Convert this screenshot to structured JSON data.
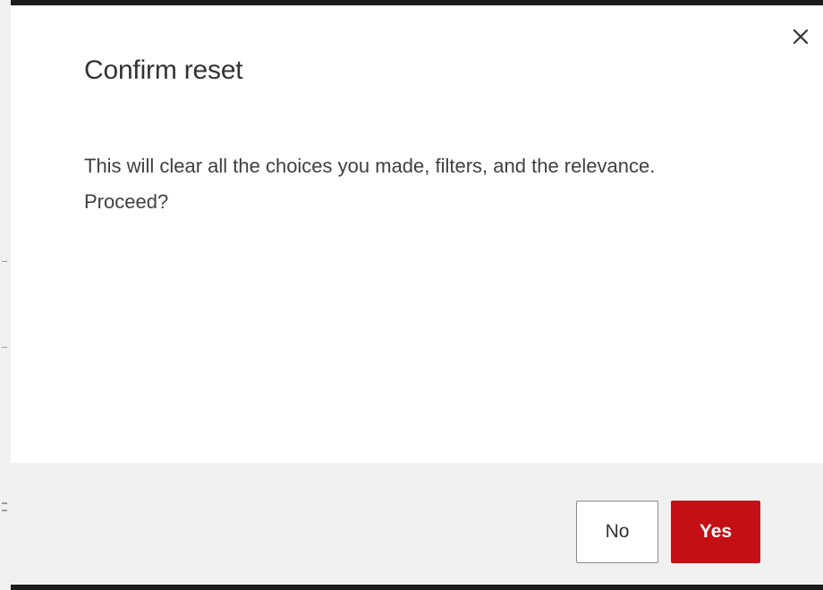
{
  "dialog": {
    "title": "Confirm reset",
    "message": "This will clear all the choices you made, filters, and the relevance. Proceed?",
    "close_icon": "close-icon",
    "buttons": {
      "no_label": "No",
      "yes_label": "Yes"
    }
  },
  "colors": {
    "primary": "#c40f14",
    "footer_background": "#f0f0f0",
    "title_text": "#333333"
  }
}
